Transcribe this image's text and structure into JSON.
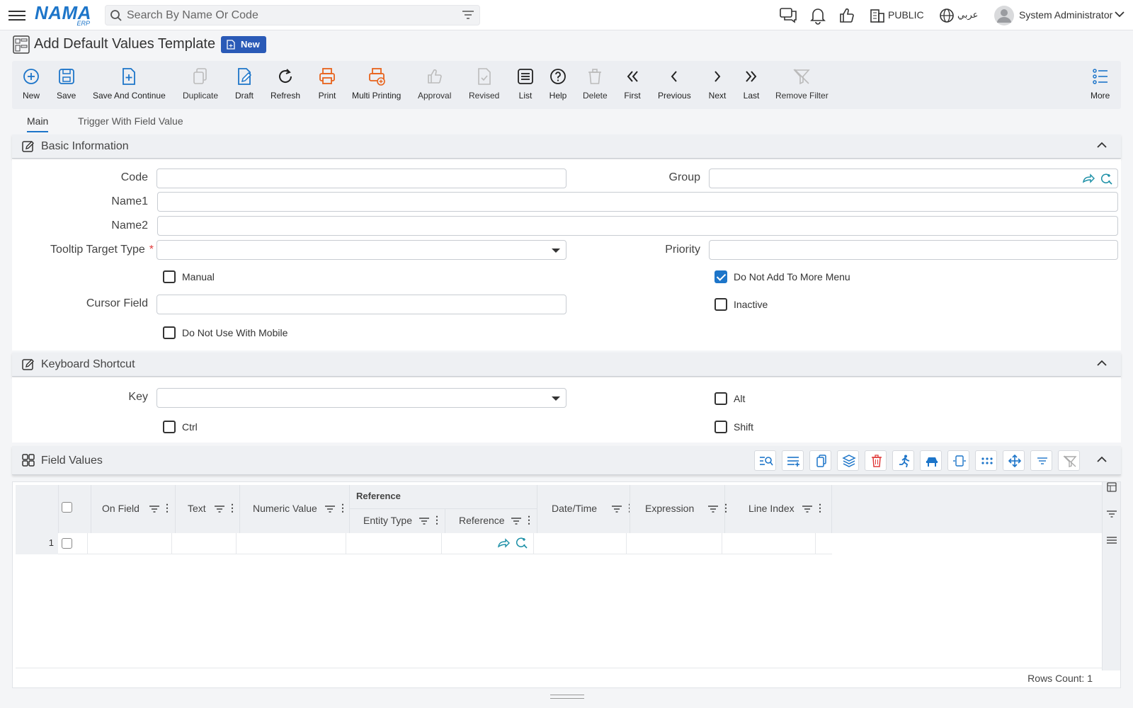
{
  "header": {
    "logo_text": "NAMA",
    "logo_sub": "ERP",
    "search_placeholder": "Search By Name Or Code",
    "branch": "PUBLIC",
    "language": "عربي",
    "user": "System Administrator"
  },
  "page": {
    "title": "Add Default Values Template",
    "status_badge": "New"
  },
  "toolbar": {
    "new": "New",
    "save": "Save",
    "save_continue": "Save And Continue",
    "duplicate": "Duplicate",
    "draft": "Draft",
    "refresh": "Refresh",
    "print": "Print",
    "multi_printing": "Multi Printing",
    "approval": "Approval",
    "revised": "Revised",
    "list": "List",
    "help": "Help",
    "delete": "Delete",
    "first": "First",
    "previous": "Previous",
    "next": "Next",
    "last": "Last",
    "remove_filter": "Remove Filter",
    "more": "More"
  },
  "tabs": {
    "main": "Main",
    "trigger": "Trigger With Field Value"
  },
  "basic": {
    "title": "Basic Information",
    "code_label": "Code",
    "code_value": "",
    "group_label": "Group",
    "group_value": "",
    "name1_label": "Name1",
    "name1_value": "",
    "name2_label": "Name2",
    "name2_value": "",
    "tooltip_label": "Tooltip Target Type",
    "tooltip_value": "",
    "priority_label": "Priority",
    "priority_value": "",
    "manual_label": "Manual",
    "manual_checked": false,
    "no_more_menu_label": "Do Not Add To More Menu",
    "no_more_menu_checked": true,
    "cursor_label": "Cursor Field",
    "cursor_value": "",
    "inactive_label": "Inactive",
    "inactive_checked": false,
    "no_mobile_label": "Do Not Use With Mobile",
    "no_mobile_checked": false
  },
  "keyboard": {
    "title": "Keyboard Shortcut",
    "key_label": "Key",
    "key_value": "",
    "alt_label": "Alt",
    "ctrl_label": "Ctrl",
    "shift_label": "Shift"
  },
  "field_values": {
    "title": "Field Values",
    "columns": {
      "on_field": "On Field",
      "text": "Text",
      "numeric_value": "Numeric Value",
      "reference_group": "Reference",
      "entity_type": "Entity Type",
      "reference": "Reference",
      "date_time": "Date/Time",
      "expression": "Expression",
      "line_index": "Line Index"
    },
    "rows": [
      {
        "index": "1",
        "on_field": "",
        "text": "",
        "numeric_value": "",
        "entity_type": "",
        "reference": "",
        "date_time": "",
        "expression": "",
        "line_index": ""
      }
    ],
    "rows_count": "Rows Count: 1"
  },
  "colors": {
    "accent": "#1d75c9",
    "badge": "#2a5ab7",
    "print_orange": "#e8631c",
    "teal": "#1b8fa6",
    "danger": "#e03b3b"
  }
}
